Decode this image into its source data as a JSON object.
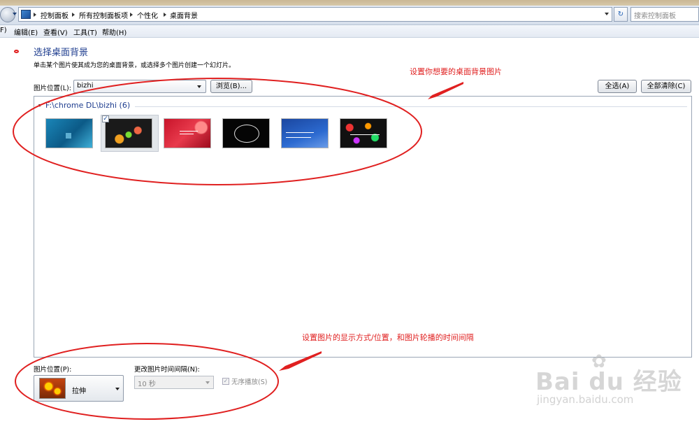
{
  "address_bar": {
    "breadcrumbs": [
      "控制面板",
      "所有控制面板项",
      "个性化",
      "桌面背景"
    ],
    "refresh_label": "↻",
    "search_placeholder": "搜索控制面板"
  },
  "menu": {
    "items": [
      "F)",
      "编辑(E)",
      "查看(V)",
      "工具(T)",
      "帮助(H)"
    ]
  },
  "content": {
    "title": "选择桌面背景",
    "description": "单击某个图片使其成为您的桌面背景，或选择多个图片创建一个幻灯片。",
    "location_label": "图片位置(L):",
    "location_value": "bizhi",
    "browse_label": "浏览(B)...",
    "select_all_label": "全选(A)",
    "clear_all_label": "全部清除(C)"
  },
  "gallery": {
    "group_label": "F:\\chrome DL\\bizhi (6)",
    "selected_check": "✓",
    "thumbnails": [
      {
        "name": "wallpaper-1"
      },
      {
        "name": "wallpaper-2",
        "selected": true
      },
      {
        "name": "wallpaper-3"
      },
      {
        "name": "wallpaper-4"
      },
      {
        "name": "wallpaper-5"
      },
      {
        "name": "wallpaper-6"
      }
    ]
  },
  "bottom": {
    "position_label": "图片位置(P):",
    "position_value": "拉伸",
    "interval_label": "更改图片时间间隔(N):",
    "interval_value": "10 秒",
    "shuffle_check": "✓",
    "shuffle_label": "无序播放(S)"
  },
  "annotations": {
    "top": "设置你想要的桌面背景图片",
    "bottom": "设置图片的显示方式/位置，和图片轮播的时间间隔",
    "color": "#e02020"
  },
  "watermark": {
    "main": "Bai du 经验",
    "paw": "✿",
    "sub": "jingyan.baidu.com"
  }
}
